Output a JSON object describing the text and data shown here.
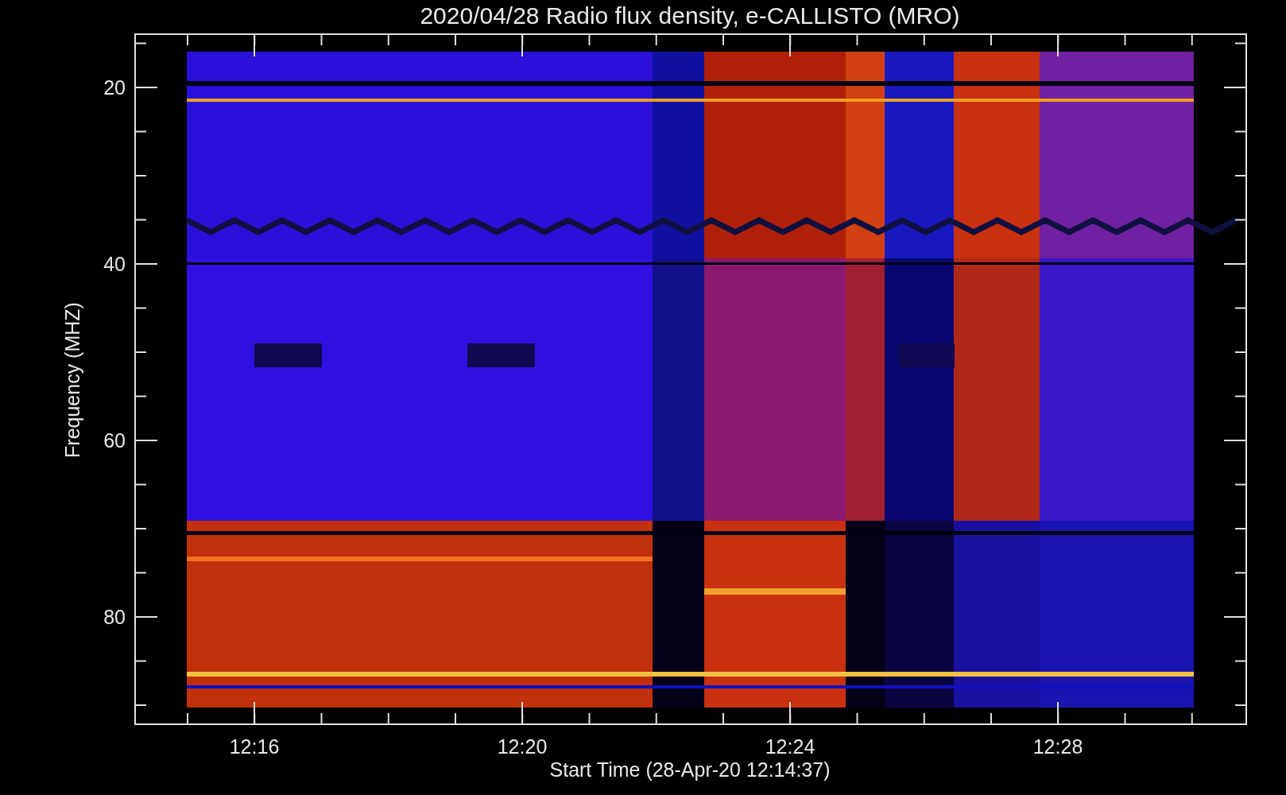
{
  "title": "2020/04/28  Radio flux density, e-CALLISTO (MRO)",
  "y_axis": {
    "label": "Frequency (MHZ)",
    "ticks": [
      "20",
      "40",
      "60",
      "80"
    ]
  },
  "x_axis": {
    "label": "Start Time (28-Apr-20 12:14:37)",
    "ticks": [
      "12:16",
      "12:20",
      "12:24",
      "12:28"
    ]
  }
}
